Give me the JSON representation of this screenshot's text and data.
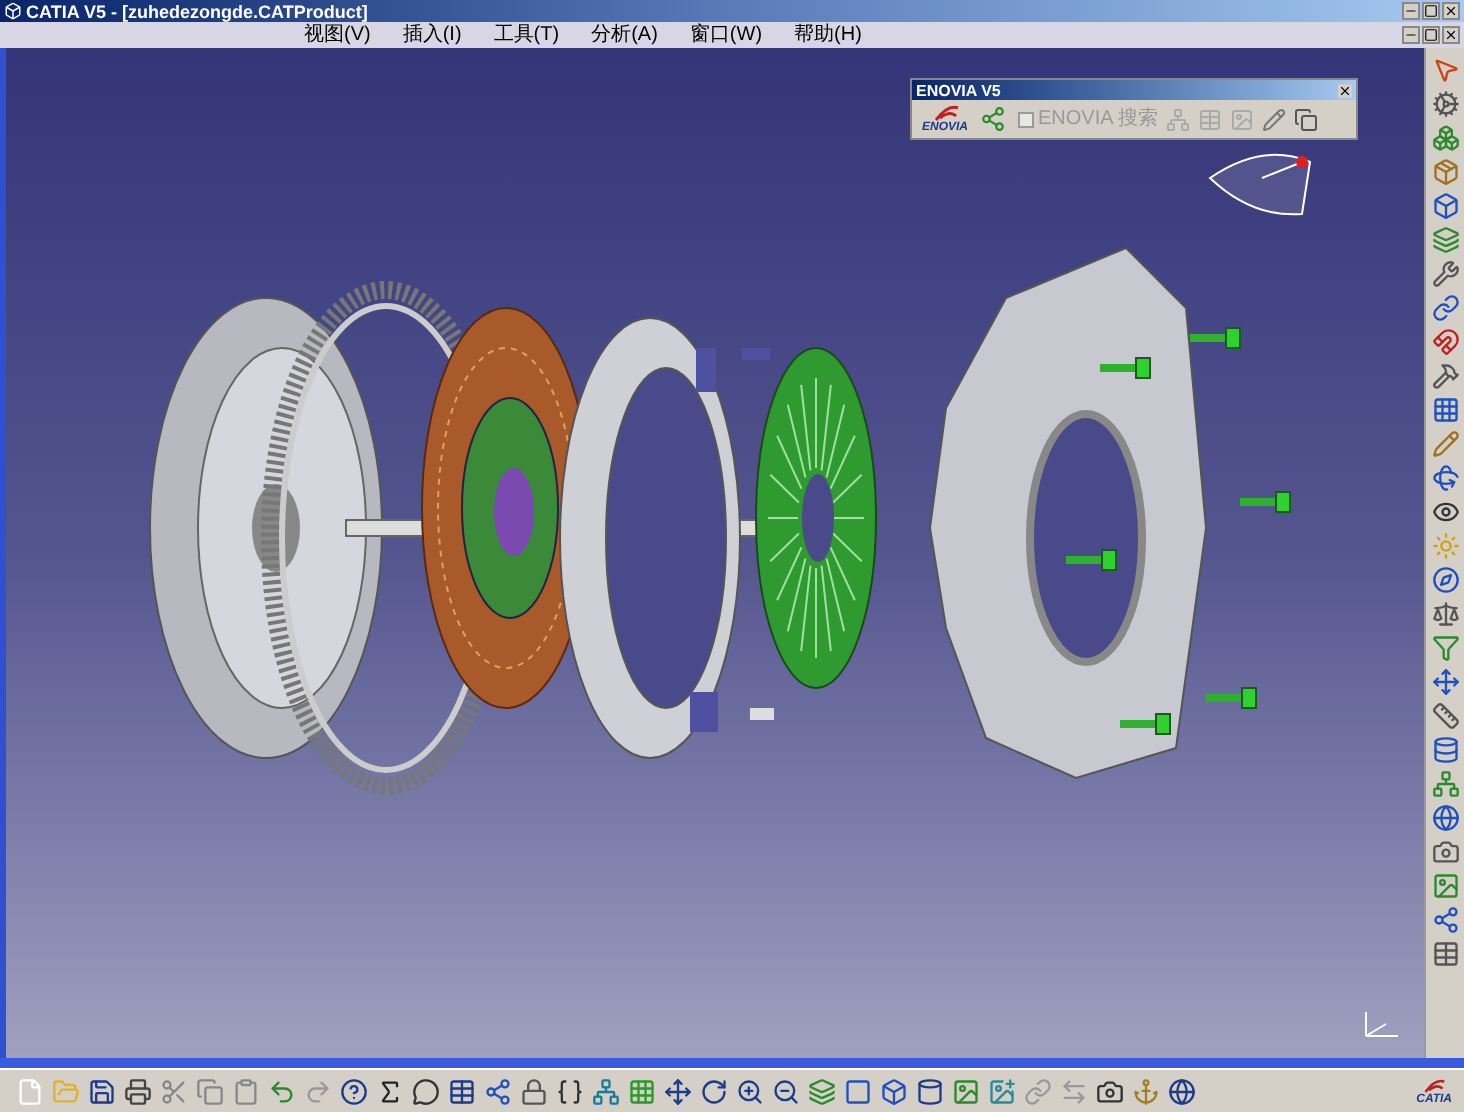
{
  "window": {
    "title": "CATIA V5 - [zuhedezongde.CATProduct]"
  },
  "menu": [
    {
      "label": "视图(V)"
    },
    {
      "label": "插入(I)"
    },
    {
      "label": "工具(T)"
    },
    {
      "label": "分析(A)"
    },
    {
      "label": "窗口(W)"
    },
    {
      "label": "帮助(H)"
    }
  ],
  "enovia_toolbar": {
    "title": "ENOVIA V5",
    "logo_text": "ENOVIA",
    "search_checkbox": {
      "label": "ENOVIA 搜索",
      "checked": false,
      "disabled": true
    }
  },
  "catia_logo": {
    "text": "CATIA"
  }
}
